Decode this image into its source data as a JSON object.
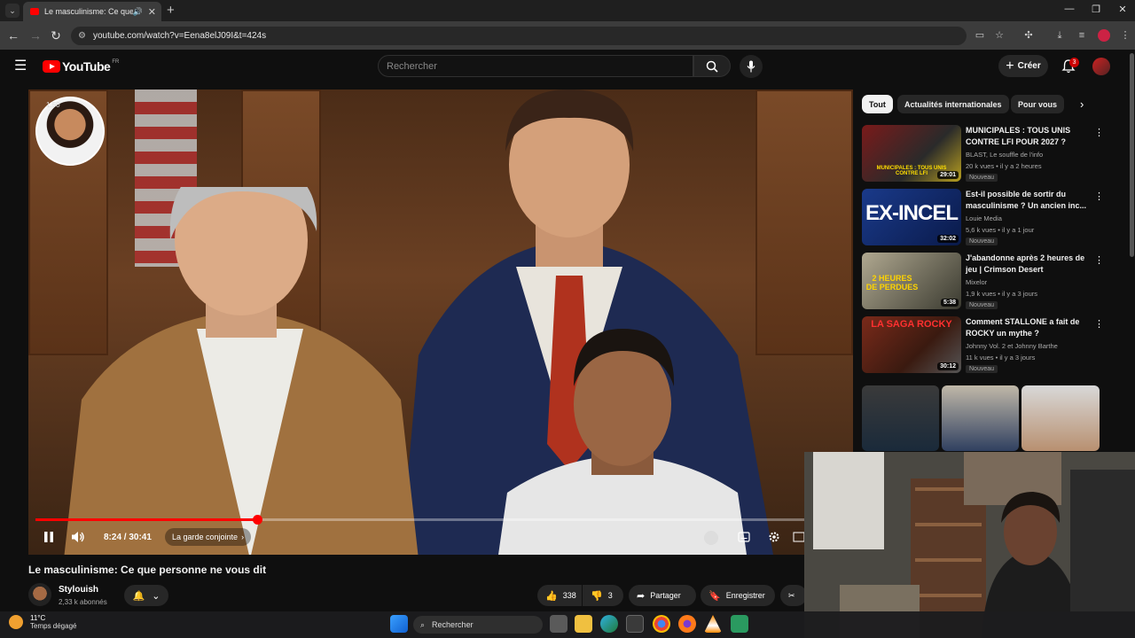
{
  "browser": {
    "tab_title": "Le masculinisme: Ce que pe",
    "url": "youtube.com/watch?v=Eena8elJ09I&t=424s"
  },
  "youtube": {
    "logo_text": "YouTube",
    "logo_country": "FR",
    "search_placeholder": "Rechercher",
    "create_label": "Créer",
    "notification_count": "3"
  },
  "player": {
    "overlay_time": "1:50",
    "current_time": "8:24 / 30:41",
    "chapter": "La garde conjointe",
    "progress_fraction": 0.274
  },
  "video": {
    "title": "Le masculinisme: Ce que personne ne vous dit",
    "channel": "Stylouish",
    "subscribers": "2,33 k abonnés",
    "likes": "338",
    "dislikes": "3",
    "share_label": "Partager",
    "save_label": "Enregistrer"
  },
  "chips": [
    "Tout",
    "Actualités internationales",
    "Pour vous"
  ],
  "recommendations": [
    {
      "title": "MUNICIPALES : TOUS UNIS CONTRE LFI POUR 2027 ?",
      "channel": "BLAST, Le souffle de l'info",
      "meta": "20 k vues • il y a 2 heures",
      "badge": "Nouveau",
      "duration": "29:01",
      "thumb_text": "MUNICIPALES : TOUS UNIS CONTRE LFI"
    },
    {
      "title": "Est-il possible de sortir du masculinisme ? Un ancien inc...",
      "channel": "Louie Media",
      "meta": "5,6 k vues • il y a 1 jour",
      "badge": "Nouveau",
      "duration": "32:02",
      "thumb_text": "EX-INCEL"
    },
    {
      "title": "J'abandonne après 2 heures de jeu | Crimson Desert",
      "channel": "Mixelor",
      "meta": "1,9 k vues • il y a 3 jours",
      "badge": "Nouveau",
      "duration": "5:38",
      "thumb_text": "2 HEURES DE PERDUES"
    },
    {
      "title": "Comment STALLONE a fait de ROCKY un mythe ?",
      "channel": "Johnny Vol. 2 et Johnny Barthe",
      "meta": "11 k vues • il y a 3 jours",
      "badge": "Nouveau",
      "duration": "30:12",
      "thumb_text": "LA SAGA ROCKY"
    }
  ],
  "taskbar": {
    "temperature": "11°C",
    "weather": "Temps dégagé",
    "search": "Rechercher"
  },
  "colors": {
    "brand": "#ff0000",
    "background": "#0f0f0f",
    "chip_active": "#f1f1f1"
  }
}
